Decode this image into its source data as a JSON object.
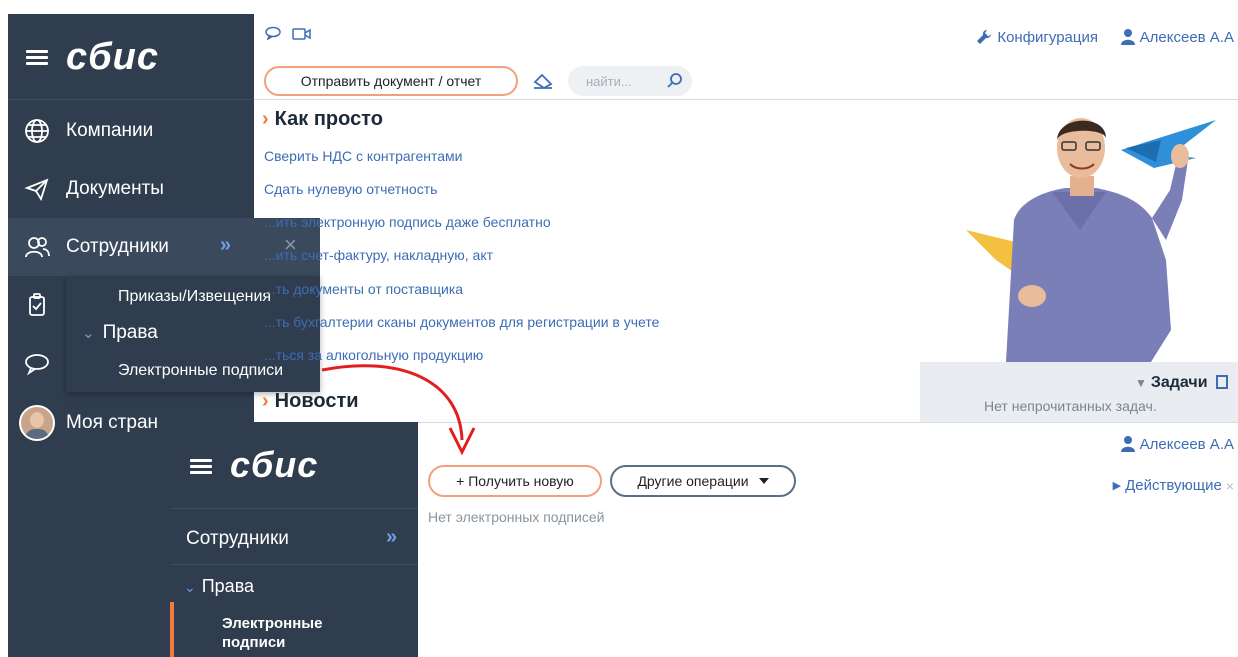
{
  "back": {
    "logo": "сбис",
    "nav": {
      "companies": "Компании",
      "documents": "Документы",
      "employees": "Сотрудники",
      "my_page": "Моя стран"
    },
    "submenu": {
      "orders": "Приказы/Извещения",
      "rights": "Права",
      "signatures": "Электронные подписи"
    },
    "topbar": {
      "send_button": "Отправить документ / отчет",
      "search_placeholder": "найти...",
      "config": "Конфигурация",
      "user": "Алексеев А.А"
    },
    "how_title": "Как просто",
    "links": [
      "Сверить НДС с контрагентами",
      "Сдать нулевую отчетность",
      "...ить электронную подпись даже бесплатно",
      "...ить счет-фактуру, накладную, акт",
      "...ть документы от поставщика",
      "...ть бухгалтерии сканы документов для регистрации в учете",
      "...ться за алкогольную продукцию"
    ],
    "news_title": "Новости",
    "tasks": {
      "title": "Задачи",
      "empty": "Нет непрочитанных задач."
    }
  },
  "front": {
    "logo": "сбис",
    "section": "Сотрудники",
    "rights": "Права",
    "signatures_line1": "Электронные",
    "signatures_line2": "подписи",
    "user": "Алексеев А.А",
    "get_new_button": "+ Получить новую",
    "other_ops_button": "Другие операции",
    "empty": "Нет электронных подписей",
    "filter": "Действующие"
  },
  "colors": {
    "sidebar": "#2f3d4e",
    "accent": "#f07a3e",
    "link": "#3d6db5",
    "arrow": "#e02020"
  }
}
